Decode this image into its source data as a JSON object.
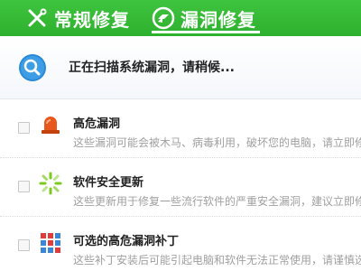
{
  "tabs": [
    {
      "label": "常规修复",
      "icon": "wrench-screwdriver-icon"
    },
    {
      "label": "漏洞修复",
      "icon": "shield-patch-icon",
      "active": true
    }
  ],
  "scan": {
    "status": "正在扫描系统漏洞，请稍候...",
    "icon": "magnifier-icon"
  },
  "items": [
    {
      "title": "高危漏洞",
      "description": "这些漏洞可能会被木马、病毒利用，破坏您的电脑，请立即修复",
      "icon": "siren-icon",
      "checked": false
    },
    {
      "title": "软件安全更新",
      "description": "这些更新用于修复一些流行软件的严重安全漏洞，建议立即修复",
      "icon": "loading-spinner-icon",
      "checked": false
    },
    {
      "title": "可选的高危漏洞补丁",
      "description": "这些补丁安装后可能引起电脑和软件无法正常使用，请谨慎选择",
      "icon": "windows-blocks-icon",
      "checked": false
    }
  ],
  "colors": {
    "topbar_green": "#2eb12e",
    "siren_orange": "#e8581c",
    "spinner_green": "#7ccb1c",
    "magnifier_blue": "#2a8ad8"
  }
}
